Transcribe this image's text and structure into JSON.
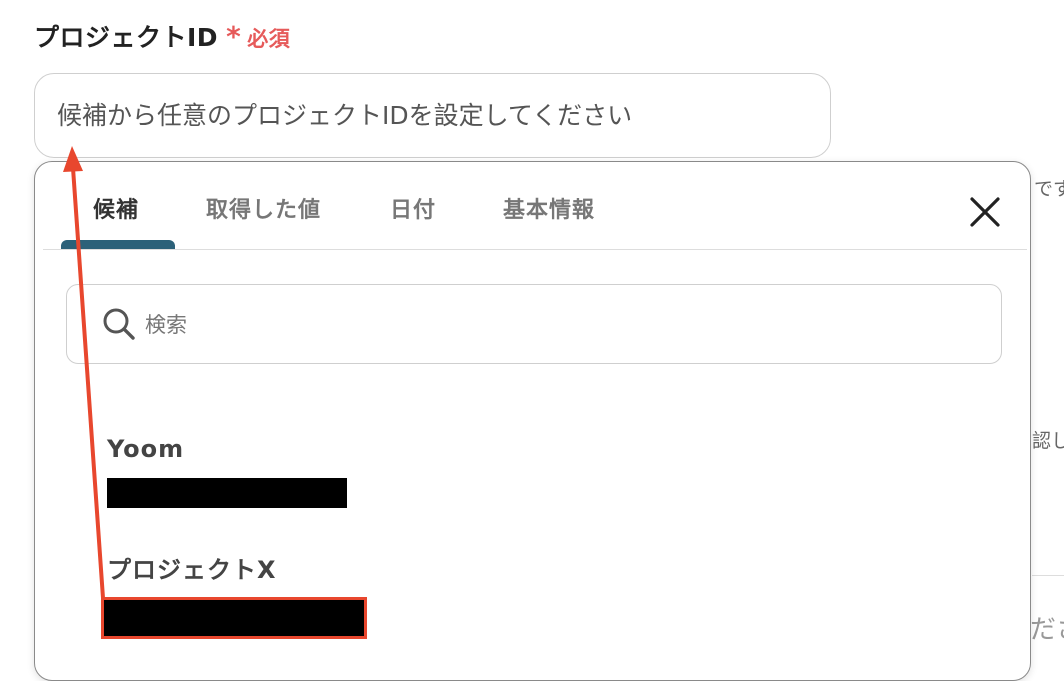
{
  "field": {
    "label": "プロジェクトID",
    "required_mark": "*",
    "required_text": "必須",
    "placeholder": "候補から任意のプロジェクトIDを設定してください"
  },
  "background": {
    "fragment_1": "です",
    "fragment_2": "認し",
    "fragment_3": "ださ"
  },
  "popover": {
    "tabs": [
      {
        "label": "候補",
        "active": true
      },
      {
        "label": "取得した値",
        "active": false
      },
      {
        "label": "日付",
        "active": false
      },
      {
        "label": "基本情報",
        "active": false
      }
    ],
    "search_placeholder": "検索",
    "options": [
      {
        "name": "Yoom",
        "id_redacted": true
      },
      {
        "name": "プロジェクトX",
        "id_redacted": true,
        "highlighted": true
      }
    ]
  },
  "annotation": {
    "color": "#e8472e"
  },
  "colors": {
    "required": "#e65a5a",
    "tab_indicator": "#2c6179",
    "annotation": "#e8472e"
  }
}
